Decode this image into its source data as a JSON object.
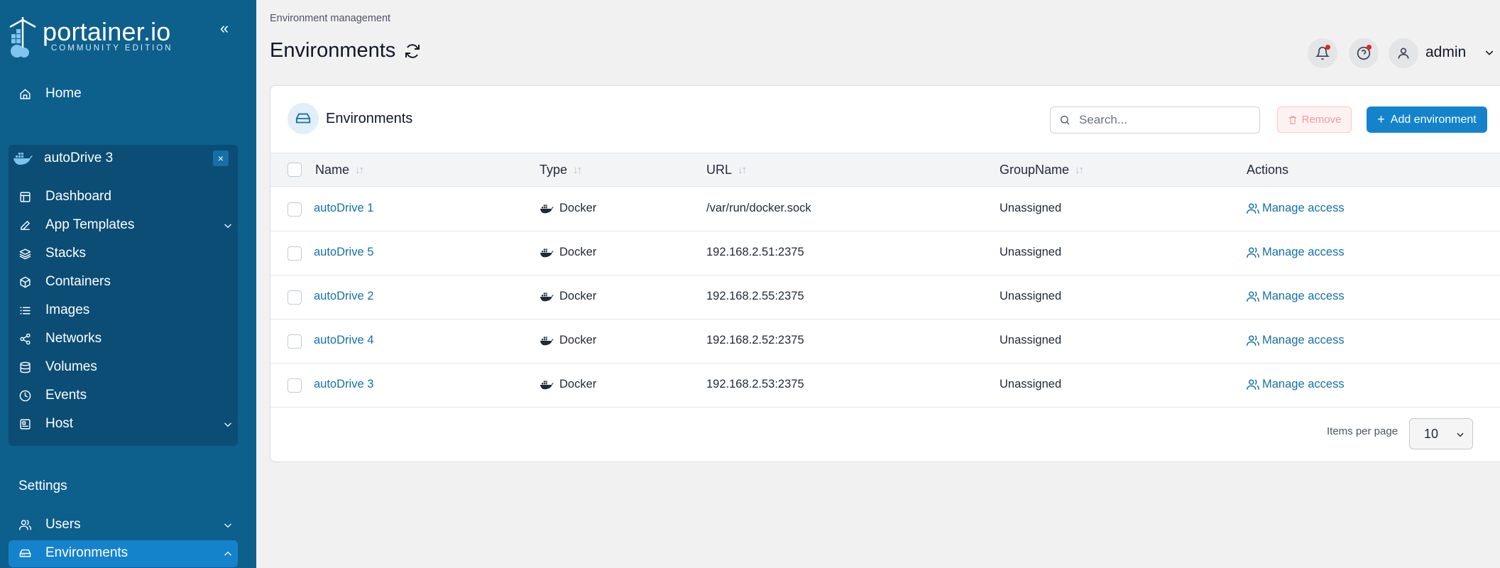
{
  "app": {
    "logo_text": "portainer.io",
    "logo_sub": "COMMUNITY EDITION"
  },
  "sidebar": {
    "home": "Home",
    "environment": {
      "name": "autoDrive 3",
      "close": "×"
    },
    "items": [
      {
        "label": "Dashboard",
        "icon": "dashboard-icon"
      },
      {
        "label": "App Templates",
        "icon": "edit-icon"
      },
      {
        "label": "Stacks",
        "icon": "layers-icon"
      },
      {
        "label": "Containers",
        "icon": "box-icon"
      },
      {
        "label": "Images",
        "icon": "list-icon"
      },
      {
        "label": "Networks",
        "icon": "share-icon"
      },
      {
        "label": "Volumes",
        "icon": "database-icon"
      },
      {
        "label": "Events",
        "icon": "clock-icon"
      },
      {
        "label": "Host",
        "icon": "host-icon"
      }
    ],
    "settings_label": "Settings",
    "users": "Users",
    "environments": "Environments"
  },
  "header": {
    "breadcrumb": "Environment management",
    "title": "Environments",
    "user": "admin"
  },
  "card": {
    "title": "Environments",
    "search_placeholder": "Search...",
    "remove_label": "Remove",
    "add_label": "Add environment",
    "columns": {
      "name": "Name",
      "type": "Type",
      "url": "URL",
      "group": "GroupName",
      "actions": "Actions"
    },
    "rows": [
      {
        "name": "autoDrive 1",
        "type": "Docker",
        "url": "/var/run/docker.sock",
        "group": "Unassigned",
        "action": "Manage access"
      },
      {
        "name": "autoDrive 5",
        "type": "Docker",
        "url": "192.168.2.51:2375",
        "group": "Unassigned",
        "action": "Manage access"
      },
      {
        "name": "autoDrive 2",
        "type": "Docker",
        "url": "192.168.2.55:2375",
        "group": "Unassigned",
        "action": "Manage access"
      },
      {
        "name": "autoDrive 4",
        "type": "Docker",
        "url": "192.168.2.52:2375",
        "group": "Unassigned",
        "action": "Manage access"
      },
      {
        "name": "autoDrive 3",
        "type": "Docker",
        "url": "192.168.2.53:2375",
        "group": "Unassigned",
        "action": "Manage access"
      }
    ],
    "items_per_page_label": "Items per page",
    "items_per_page": "10"
  },
  "colors": {
    "sidebar": "#0d5f8c",
    "accent": "#1583cc",
    "link": "#1570a8"
  }
}
